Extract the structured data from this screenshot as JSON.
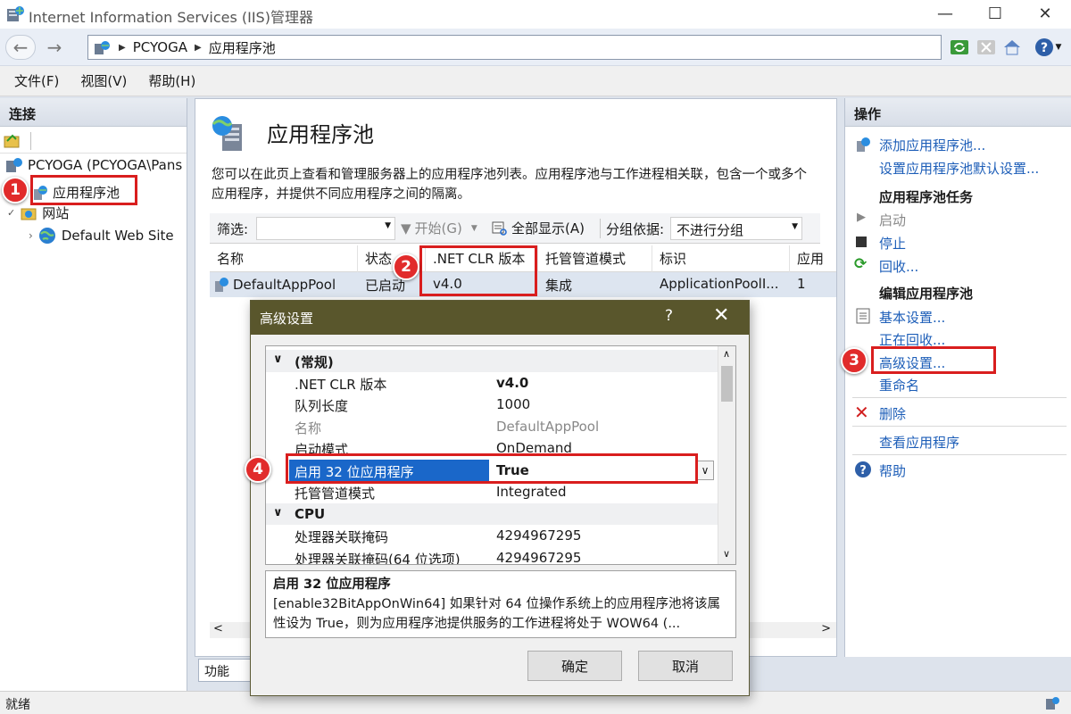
{
  "window": {
    "title": "Internet Information Services (IIS)管理器",
    "minimize": "—",
    "maximize": "☐",
    "close": "✕"
  },
  "address": {
    "back": "←",
    "forward": "→",
    "segments": [
      "PCYOGA",
      "应用程序池"
    ]
  },
  "menu": [
    "文件(F)",
    "视图(V)",
    "帮助(H)"
  ],
  "connections": {
    "header": "连接",
    "server": "PCYOGA (PCYOGA\\Pans",
    "app_pools": "应用程序池",
    "sites": "网站",
    "default_site": "Default Web Site"
  },
  "center": {
    "title": "应用程序池",
    "description": "您可以在此页上查看和管理服务器上的应用程序池列表。应用程序池与工作进程相关联，包含一个或多个应用程序，并提供不同应用程序之间的隔离。",
    "filter_label": "筛选:",
    "start_btn": "开始(G)",
    "show_all_btn": "全部显示(A)",
    "group_label": "分组依据:",
    "group_value": "不进行分组",
    "columns": [
      "名称",
      "状态",
      ".NET CLR 版本",
      "托管管道模式",
      "标识",
      "应用"
    ],
    "row": [
      "DefaultAppPool",
      "已启动",
      "v4.0",
      "集成",
      "ApplicationPoolI...",
      "1"
    ],
    "bottom_tab": "功能"
  },
  "actions": {
    "header": "操作",
    "add_pool": "添加应用程序池...",
    "set_defaults": "设置应用程序池默认设置...",
    "tasks_header": "应用程序池任务",
    "start": "启动",
    "stop": "停止",
    "recycle": "回收...",
    "edit_header": "编辑应用程序池",
    "basic_settings": "基本设置...",
    "recycling": "正在回收...",
    "advanced_settings": "高级设置...",
    "rename": "重命名",
    "delete": "删除",
    "view_apps": "查看应用程序",
    "help": "帮助"
  },
  "status": {
    "text": "就绪"
  },
  "dialog": {
    "title": "高级设置",
    "help": "?",
    "close": "✕",
    "rows": [
      {
        "type": "cat",
        "name": "(常规)"
      },
      {
        "name": ".NET CLR 版本",
        "value": "v4.0",
        "bold": true
      },
      {
        "name": "队列长度",
        "value": "1000"
      },
      {
        "name": "名称",
        "value": "DefaultAppPool",
        "dim": true
      },
      {
        "name": "启动模式",
        "value": "OnDemand"
      },
      {
        "name": "启用 32 位应用程序",
        "value": "True",
        "selected": true,
        "bold": true
      },
      {
        "name": "托管管道模式",
        "value": "Integrated"
      },
      {
        "type": "cat",
        "name": "CPU"
      },
      {
        "name": "处理器关联掩码",
        "value": "4294967295"
      },
      {
        "name": "处理器关联掩码(64 位选项)",
        "value": "4294967295"
      }
    ],
    "desc_title": "启用 32 位应用程序",
    "desc_text": "[enable32BitAppOnWin64] 如果针对 64 位操作系统上的应用程序池将该属性设为 True，则为应用程序池提供服务的工作进程将处于 WOW64 (...",
    "ok": "确定",
    "cancel": "取消"
  },
  "badges": [
    "1",
    "2",
    "3",
    "4"
  ],
  "colors": {
    "highlight": "#d91e1e",
    "dialog_title": "#59562c",
    "selection": "#1a67c9",
    "link": "#1d5eb8"
  }
}
